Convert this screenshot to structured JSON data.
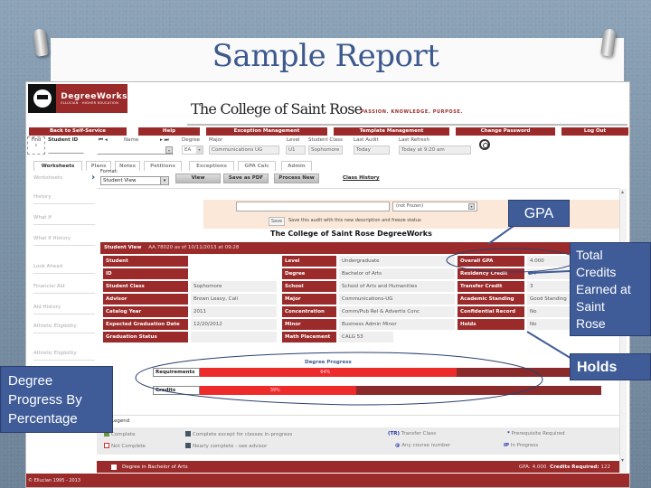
{
  "slide": {
    "title": "Sample Report"
  },
  "app": {
    "logo_name": "DegreeWorks",
    "logo_sub": "ELLUCIAN · HIGHER EDUCATION",
    "college_name": "The College of Saint Rose",
    "college_tagline": "PASSION. KNOWLEDGE. PURPOSE."
  },
  "nav": [
    {
      "label": "Back to Self-Service"
    },
    {
      "label": "Help"
    },
    {
      "label": "Exception Management"
    },
    {
      "label": "Template Management"
    },
    {
      "label": "Change Password"
    },
    {
      "label": "Log Out"
    }
  ],
  "student_bar": {
    "find_label": "Find",
    "student_id_label": "Student ID",
    "name_label": "Name",
    "degree_label": "Degree",
    "degree_value": "EA",
    "major_label": "Major",
    "major_value": "Communications UG",
    "level_label": "Level",
    "level_value": "U1",
    "class_label": "Student Class",
    "class_value": "Sophomore",
    "last_audit_label": "Last Audit",
    "last_audit_value": "Today",
    "last_refresh_label": "Last Refresh",
    "last_refresh_value": "Today at 9:20 am"
  },
  "tabs": [
    {
      "label": "Worksheets",
      "active": true
    },
    {
      "label": "Plans"
    },
    {
      "label": "Notes"
    },
    {
      "label": "Petitions"
    },
    {
      "label": "Exceptions"
    },
    {
      "label": "GPA Calc"
    },
    {
      "label": "Admin"
    }
  ],
  "sidebar": {
    "items": [
      {
        "label": "Worksheets"
      },
      {
        "label": "History"
      },
      {
        "label": "What If"
      },
      {
        "label": "What If History"
      },
      {
        "label": "Look Ahead"
      },
      {
        "label": "Financial Aid"
      },
      {
        "label": "Aid History"
      },
      {
        "label": "Athletic Eligibility"
      },
      {
        "label": "Athletic Eligibility"
      }
    ]
  },
  "toolbar": {
    "format_label": "Format:",
    "format_value": "Student View",
    "view_label": "View",
    "save_pdf_label": "Save as PDF",
    "process_new_label": "Process New",
    "class_history_label": "Class History"
  },
  "freeze": {
    "select_value": "(not Frozen)",
    "save_label": "Save",
    "save_desc": "Save this audit with this new description and freeze status"
  },
  "audit": {
    "title": "The College of Saint Rose DegreeWorks",
    "view_label": "Student View",
    "view_meta": "AA.78020 as of 10/11/2013 at 09:28",
    "col1": [
      {
        "label": "Student",
        "value": ""
      },
      {
        "label": "ID",
        "value": ""
      },
      {
        "label": "Student Class",
        "value": "Sophomore"
      },
      {
        "label": "Advisor",
        "value": "Brown Leavy, Cali"
      },
      {
        "label": "Catalog Year",
        "value": "2011"
      },
      {
        "label": "Expected Graduation Date",
        "value": "12/20/2012"
      },
      {
        "label": "Graduation Status",
        "value": ""
      }
    ],
    "col2": [
      {
        "label": "Level",
        "value": "Undergraduate"
      },
      {
        "label": "Degree",
        "value": "Bachelor of Arts"
      },
      {
        "label": "School",
        "value": "School of Arts and Humanities"
      },
      {
        "label": "Major",
        "value": "Communications-UG"
      },
      {
        "label": "Concentration",
        "value": "Comm/Pub Rel & Advertis Conc"
      },
      {
        "label": "Minor",
        "value": "Business Admin Minor"
      },
      {
        "label": "Math Placement",
        "value": "CALG 53"
      }
    ],
    "col3": [
      {
        "label": "Overall GPA",
        "value": "4.000"
      },
      {
        "label": "Residency Credit",
        "value": "44"
      },
      {
        "label": "Transfer Credit",
        "value": "3"
      },
      {
        "label": "Academic Standing",
        "value": "Good Standing"
      },
      {
        "label": "Confidential Record",
        "value": "No"
      },
      {
        "label": "Holds",
        "value": "No"
      }
    ]
  },
  "degree_progress": {
    "title": "Degree Progress",
    "bars": [
      {
        "label": "Requirements",
        "percent": 64,
        "percent_label": "64%"
      },
      {
        "label": "Credits",
        "percent": 39,
        "percent_label": "39%"
      }
    ]
  },
  "legend": {
    "title": "Legend",
    "items": [
      {
        "label": "Complete",
        "icon": "complete-check-icon"
      },
      {
        "label": "Not Complete",
        "icon": "not-complete-box-icon"
      },
      {
        "label": "Complete except for classes in-progress",
        "icon": "in-progress-box-icon"
      },
      {
        "label": "Nearly complete - see advisor",
        "icon": "nearly-complete-box-icon"
      },
      {
        "key": "(TR)",
        "label": "Transfer Class"
      },
      {
        "key": "@",
        "label": "Any course number"
      },
      {
        "key": "*",
        "label": "Prerequisite Required"
      },
      {
        "key": "IP",
        "label": "In Progress"
      }
    ]
  },
  "footer": {
    "degree_label": "Degree in Bachelor of Arts",
    "gpa_label": "GPA:",
    "gpa_value": "4.000",
    "credits_label": "Credits Required:",
    "credits_value": "122",
    "copyright": "© Ellucian 1995 - 2013"
  },
  "callouts": {
    "gpa": "GPA",
    "credits": [
      "Total",
      "Credits",
      "Earned at",
      "Saint",
      "Rose"
    ],
    "holds": "Holds",
    "progress": [
      "Degree",
      "Progress By",
      "Percentage"
    ]
  },
  "colors": {
    "brand_maroon": "#9b2a2a",
    "progress_fill": "#ee2b2b",
    "progress_track": "#8b2a2a",
    "callout_blue": "#3f5c99",
    "title_blue": "#3d5a8f"
  }
}
